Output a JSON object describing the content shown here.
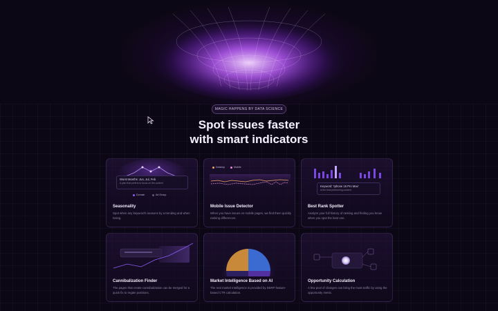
{
  "hero": {
    "badge": "MAGIC HAPPENS BY DATA SCIENCE",
    "headline_line1": "Spot issues faster",
    "headline_line2": "with smart indicators"
  },
  "cards": [
    {
      "title": "Seasonality",
      "description": "Spot when any keyword's seasons by a trending and when losing.",
      "visual": {
        "panel_title": "Worst Months: Jun, Jul, Feb",
        "panel_sub": "A plan that prefers to focus on the content",
        "legend_a": "Domain",
        "legend_b": "Ad Group"
      }
    },
    {
      "title": "Mobile Issue Detector",
      "description": "When you have issues on mobile pages, we find them quickly ranking differences.",
      "visual": {
        "legend_a": "Desktop",
        "legend_b": "Mobile"
      }
    },
    {
      "title": "Best Rank Spotter",
      "description": "Analyze your full history of ranking and finding you know when you spot the best one.",
      "visual": {
        "panel_title": "Keyword: 'Iphone 15 Pro Max'",
        "panel_sub": "is the best performing content"
      }
    },
    {
      "title": "Cannibalization Finder",
      "description": "The pages that create cannibalization can be merged for a quick fix to regain positions.",
      "visual": {}
    },
    {
      "title": "Market Intelligence Based on AI",
      "description": "The real market intelligence is provided by SERP feature-based CTR calculation.",
      "visual": {}
    },
    {
      "title": "Opportunity Calculation",
      "description": "A few pool of changes can bring the most traffic by using the opportunity metric.",
      "visual": {}
    }
  ],
  "colors": {
    "background": "#0c0714",
    "accent": "#8b5cf6",
    "accent_light": "#c4a5ff",
    "desktop_line": "#f0a56a",
    "mobile_line": "#e08bd8"
  },
  "icons": {
    "cursor": "cursor-arrow-icon"
  }
}
